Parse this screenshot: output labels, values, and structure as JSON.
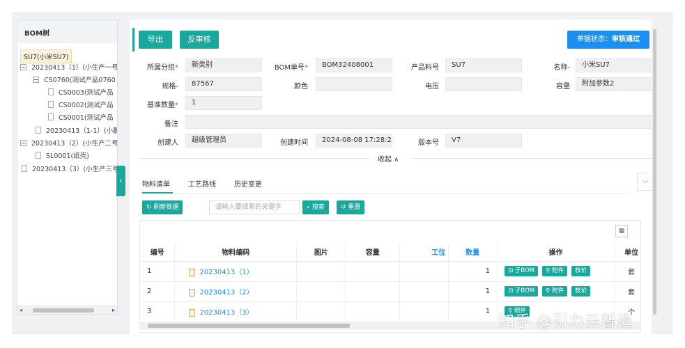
{
  "tree": {
    "title": "BOM树",
    "root": "SU7(小米SU7)",
    "nodes": [
      "20230413（1）(小生产一号",
      "CS0760(测试产品0760",
      "CS0003(测试产品",
      "CS0002(测试产品",
      "CS0001(测试产品",
      "20230413（1-1）(小鹏",
      "20230413（2）(小生产二号",
      "SL0001(纸壳)",
      "20230413（3）(小生产三号"
    ]
  },
  "toolbar": {
    "export_label": "导出",
    "unaudit_label": "反审核",
    "status_prefix": "单据状态：",
    "status_value": "审核通过"
  },
  "form": {
    "group_label": "所属分组",
    "group_value": "新类别",
    "bom_no_label": "BOM单号",
    "bom_no_value": "BOM32408001",
    "product_no_label": "产品料号",
    "product_no_value": "SU7",
    "name_label": "名称",
    "name_value": "小米SU7",
    "spec_label": "规格",
    "spec_value": "87567",
    "color_label": "颜色",
    "color_value": "",
    "voltage_label": "电压",
    "voltage_value": "",
    "capacity_label": "容量",
    "capacity_value": "附加参数2",
    "base_qty_label": "基准数量",
    "base_qty_value": "1",
    "remark_label": "备注",
    "remark_value": "",
    "creator_label": "创建人",
    "creator_value": "超级管理员",
    "created_label": "创建时间",
    "created_value": "2024-08-08 17:28:27",
    "version_label": "版本号",
    "version_value": "V7",
    "collapse_label": "收起 ∧"
  },
  "tabs": [
    "物料清单",
    "工艺路线",
    "历史变更"
  ],
  "list_toolbar": {
    "refresh_label": "刷新数据",
    "search_placeholder": "请输入要搜索的关键字",
    "search_label": "搜索",
    "reset_label": "重置"
  },
  "table": {
    "columns": [
      "编号",
      "物料编码",
      "图片",
      "容量",
      "工位",
      "数量",
      "操作",
      "单位"
    ],
    "rows": [
      {
        "no": "1",
        "code": "20230413（1）",
        "qty": "1",
        "unit": "套"
      },
      {
        "no": "2",
        "code": "20230413（2）",
        "qty": "1",
        "unit": "套"
      },
      {
        "no": "3",
        "code": "20230413（3）",
        "qty": "1",
        "unit": "个"
      }
    ],
    "action_sub_bom": "子BOM",
    "action_attach": "附件",
    "action_price": "核价"
  },
  "watermark": "知乎 @引力云智造",
  "colors": {
    "teal": "#1aa79c",
    "blue": "#1d8ff1"
  }
}
